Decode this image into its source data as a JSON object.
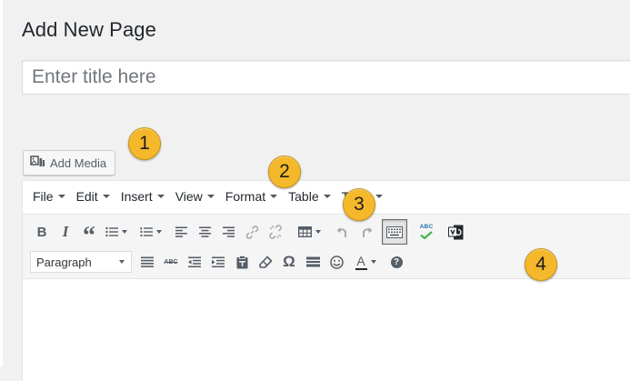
{
  "page": {
    "title": "Add New Page"
  },
  "title_field": {
    "placeholder": "Enter title here",
    "value": ""
  },
  "add_media": {
    "label": "Add Media"
  },
  "menubar": {
    "items": [
      {
        "label": "File"
      },
      {
        "label": "Edit"
      },
      {
        "label": "Insert"
      },
      {
        "label": "View"
      },
      {
        "label": "Format"
      },
      {
        "label": "Table"
      },
      {
        "label": "Tools"
      }
    ]
  },
  "toolbar": {
    "row1": [
      {
        "icon": "bold-icon",
        "glyph": "B"
      },
      {
        "icon": "italic-icon",
        "glyph": "I"
      },
      {
        "icon": "blockquote-icon",
        "glyph": "“"
      },
      {
        "icon": "bullet-list-icon"
      },
      {
        "icon": "numbered-list-icon"
      },
      {
        "icon": "align-left-icon"
      },
      {
        "icon": "align-center-icon"
      },
      {
        "icon": "align-right-icon"
      },
      {
        "icon": "insert-link-icon"
      },
      {
        "icon": "unlink-icon"
      },
      {
        "icon": "table-icon"
      },
      {
        "icon": "undo-icon"
      },
      {
        "icon": "redo-icon"
      },
      {
        "icon": "toolbar-toggle-icon"
      },
      {
        "icon": "spellcheck-icon",
        "glyph": "ABC"
      },
      {
        "icon": "plugin-icon"
      }
    ],
    "format_select": {
      "value": "Paragraph"
    },
    "row2": [
      {
        "icon": "justify-icon"
      },
      {
        "icon": "strikethrough-icon",
        "glyph": "ABC"
      },
      {
        "icon": "outdent-icon"
      },
      {
        "icon": "indent-icon"
      },
      {
        "icon": "paste-as-text-icon"
      },
      {
        "icon": "clear-formatting-icon"
      },
      {
        "icon": "special-character-icon",
        "glyph": "Ω"
      },
      {
        "icon": "horizontal-line-icon"
      },
      {
        "icon": "emoticons-icon"
      },
      {
        "icon": "text-color-icon",
        "glyph": "A"
      },
      {
        "icon": "help-icon",
        "glyph": "?"
      }
    ]
  },
  "callouts": [
    {
      "number": "1"
    },
    {
      "number": "2"
    },
    {
      "number": "3"
    },
    {
      "number": "4"
    }
  ],
  "colors": {
    "callout": "#f4b82a",
    "background": "#f1f1f1",
    "text": "#23282d",
    "icon": "#555d66"
  }
}
